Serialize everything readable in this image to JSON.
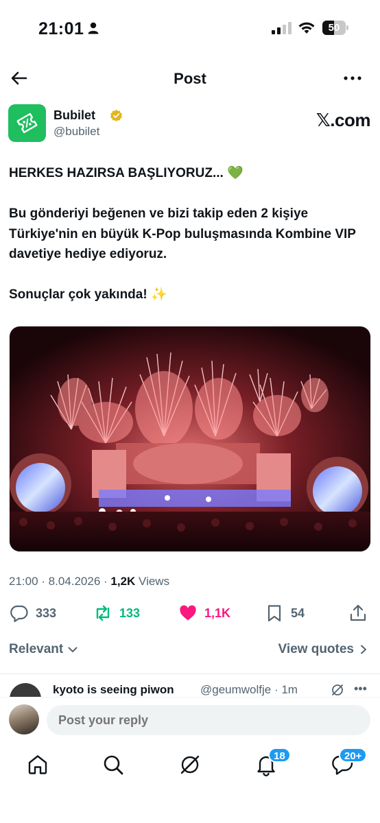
{
  "status_bar": {
    "time": "21:01",
    "battery_percent": "50",
    "battery_level": 0.5
  },
  "header": {
    "title": "Post"
  },
  "author": {
    "name": "Bubilet",
    "handle": "@bubilet",
    "verified": true,
    "source_label": "𝕏.com",
    "brand_color": "#1fbe5f"
  },
  "post": {
    "paragraphs": [
      {
        "text": "HERKES HAZIRSA BAŞLIYORUZ... ",
        "emoji": "💚"
      },
      {
        "text": "Bu gönderiyi beğenen ve bizi takip eden 2 kişiye Türkiye'nin en büyük K-Pop buluşmasında Kombine VIP davetiye hediye ediyoruz.",
        "emoji": ""
      },
      {
        "text": "Sonuçlar çok yakında! ",
        "emoji": "✨"
      }
    ],
    "media_icon": "concert-fireworks-stage-image",
    "timestamp": "21:00 · 8.04.2026 · ",
    "views_count": "1,2K",
    "views_label": " Views"
  },
  "actions": {
    "replies": "333",
    "reposts": "133",
    "likes": "1,1K",
    "bookmarks": "54",
    "liked": true,
    "reposted": true
  },
  "sort": {
    "relevant_label": "Relevant",
    "view_quotes_label": "View quotes"
  },
  "reply_preview": {
    "name": "kyoto is seeing piwon",
    "handle": "@geumwolfje · 1m"
  },
  "composer": {
    "placeholder": "Post your reply"
  },
  "nav": {
    "notifications_badge": "18",
    "messages_badge": "20+",
    "badge_color": "#1d9bf0"
  },
  "colors": {
    "text_primary": "#0f1419",
    "text_secondary": "#536471",
    "repost_green": "#00ba7c",
    "like_pink": "#f91880"
  }
}
